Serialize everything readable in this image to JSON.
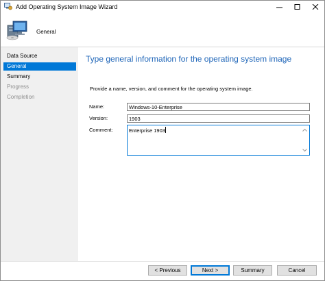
{
  "window": {
    "title": "Add Operating System Image Wizard",
    "icon": "wizard-app-icon"
  },
  "header": {
    "title": "General",
    "icon": "computer-disc-icon"
  },
  "sidebar": {
    "items": [
      {
        "label": "Data Source",
        "state": "normal"
      },
      {
        "label": "General",
        "state": "active"
      },
      {
        "label": "Summary",
        "state": "normal"
      },
      {
        "label": "Progress",
        "state": "disabled"
      },
      {
        "label": "Completion",
        "state": "disabled"
      }
    ]
  },
  "main": {
    "heading": "Type general information for the operating system image",
    "instructions": "Provide a name, version, and comment for the operating system image.",
    "fields": {
      "name": {
        "label": "Name:",
        "value": "Windows-10-Enterprise"
      },
      "version": {
        "label": "Version:",
        "value": "1903"
      },
      "comment": {
        "label": "Comment:",
        "value": "Enterprise 1903"
      }
    }
  },
  "buttons": {
    "previous": "< Previous",
    "next": "Next >",
    "summary": "Summary",
    "cancel": "Cancel"
  },
  "colors": {
    "accent": "#0078d7",
    "heading": "#1e65b8",
    "sidebar_bg": "#f0f0f0",
    "disabled_text": "#8e8e8e"
  }
}
